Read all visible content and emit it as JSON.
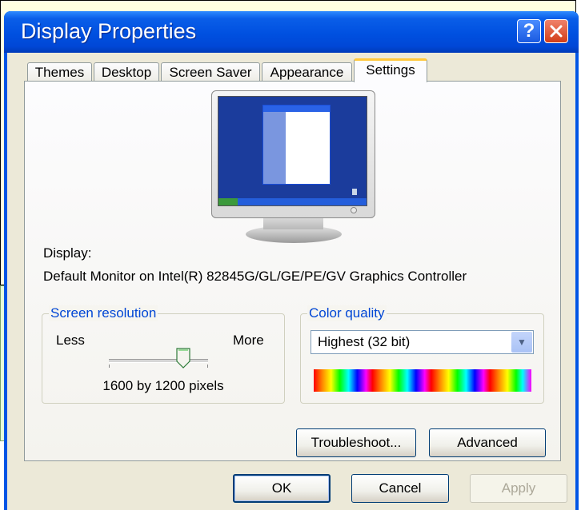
{
  "window": {
    "title": "Display Properties"
  },
  "tabs": [
    {
      "label": "Themes",
      "active": false
    },
    {
      "label": "Desktop",
      "active": false
    },
    {
      "label": "Screen Saver",
      "active": false
    },
    {
      "label": "Appearance",
      "active": false
    },
    {
      "label": "Settings",
      "active": true
    }
  ],
  "display": {
    "label": "Display:",
    "value": "Default Monitor on Intel(R) 82845G/GL/GE/PE/GV Graphics Controller"
  },
  "resolution": {
    "group_label": "Screen resolution",
    "less_label": "Less",
    "more_label": "More",
    "value_text": "1600 by 1200 pixels",
    "slider_level": 0.75
  },
  "color": {
    "group_label": "Color quality",
    "selected": "Highest (32 bit)"
  },
  "buttons": {
    "troubleshoot": "Troubleshoot...",
    "advanced": "Advanced",
    "ok": "OK",
    "cancel": "Cancel",
    "apply": "Apply"
  },
  "colors": {
    "title_bar": "#0055e5",
    "dialog_face": "#ece9d8",
    "group_label": "#0046d5",
    "monitor_screen": "#1b3c9c"
  },
  "icons": {
    "help": "help-icon",
    "close": "close-icon",
    "dropdown": "chevron-down-icon",
    "slider": "slider-thumb"
  }
}
